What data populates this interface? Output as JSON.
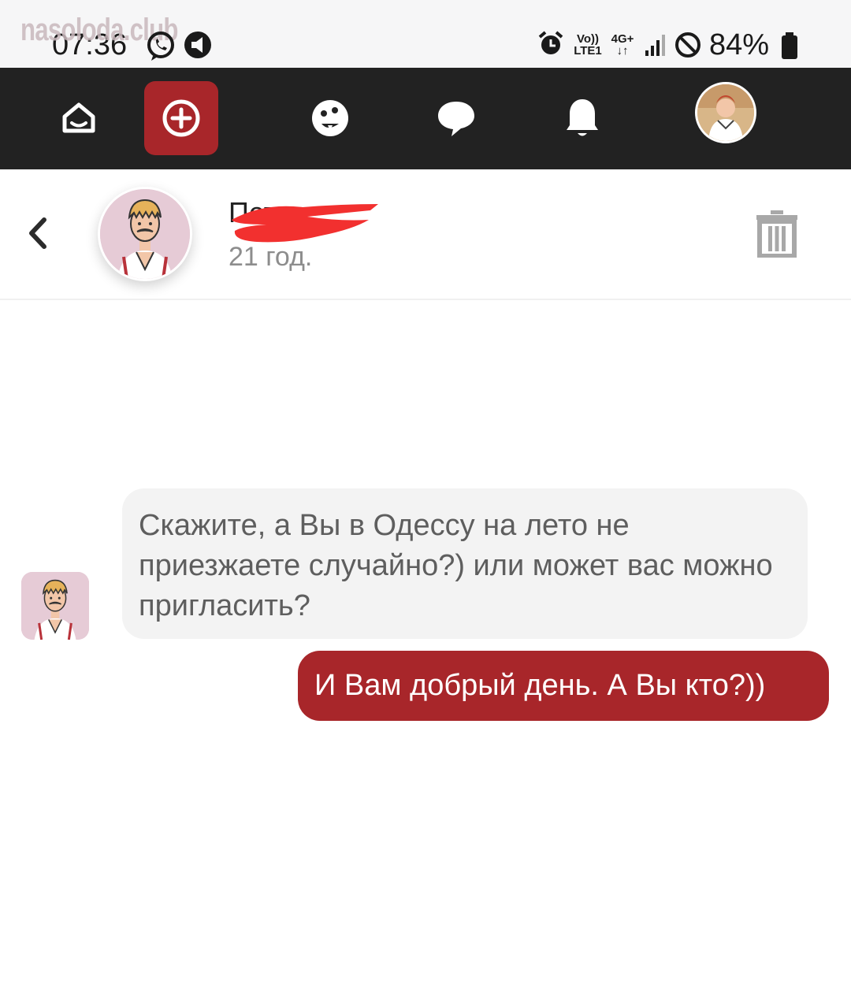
{
  "status_bar": {
    "watermark": "nasoloda.club",
    "time": "07:36",
    "network_top": "Vo))",
    "network_bottom": "LTE1",
    "network_4g": "4G+",
    "battery_percent": "84%",
    "icons": [
      "viber-icon",
      "media-icon",
      "alarm-icon",
      "signal-icon",
      "dnd-icon",
      "battery-icon"
    ]
  },
  "top_nav": {
    "items": [
      "home-icon",
      "add-icon",
      "emoji-icon",
      "chat-icon",
      "bell-icon",
      "profile-avatar"
    ],
    "accent_color": "#a8262a"
  },
  "chat_header": {
    "contact_name": "Петя",
    "contact_age": "21 год.",
    "icons": [
      "back-icon",
      "trash-icon"
    ]
  },
  "messages": [
    {
      "direction": "incoming",
      "text": "Скажите, а Вы в Одессу на лето не приезжаете случайно?) или может вас можно пригласить?"
    },
    {
      "direction": "outgoing",
      "text": "И Вам добрый день. А Вы кто?))"
    }
  ]
}
